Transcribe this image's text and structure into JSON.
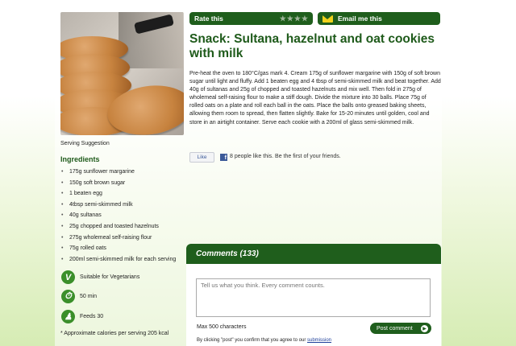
{
  "photo": {
    "caption": "Serving Suggestion"
  },
  "rate_bar": {
    "label": "Rate this",
    "stars": "★★★★"
  },
  "email_bar": {
    "label": "Email me this"
  },
  "recipe": {
    "title": "Snack: Sultana, hazelnut and oat cookies with milk",
    "method": "Pre-heat the oven to 180°C/gas mark 4. Cream 175g of sunflower margarine with 150g of soft brown sugar until light and fluffy. Add 1 beaten egg and 4 tbsp of semi-skimmed milk and beat together. Add 40g of sultanas and 25g of chopped and toasted hazelnuts and mix well. Then fold in 275g of wholemeal self-raising flour to make a stiff dough. Divide the mixture into 30 balls. Place 75g of rolled oats on a plate and roll each ball in the oats. Place the balls onto greased baking sheets, allowing them room to spread, then flatten slightly. Bake for 15-20 minutes until golden, cool and store in an airtight container. Serve each cookie with a 200ml of glass semi-skimmed milk."
  },
  "ingredients": {
    "title": "Ingredients",
    "items": [
      "175g sunflower margarine",
      "150g soft brown sugar",
      "1 beaten egg",
      "4tbsp semi-skimmed milk",
      "40g sultanas",
      "25g chopped and toasted hazelnuts",
      "275g wholemeal self-raising flour",
      "75g rolled oats",
      "200ml semi-skimmed milk for each serving"
    ]
  },
  "badges": {
    "vegetarian": {
      "icon": "V",
      "label": "Suitable for Vegetarians"
    },
    "time": {
      "icon": "⏱",
      "label": "50 min"
    },
    "feeds": {
      "icon": "♟",
      "label": "Feeds 30"
    }
  },
  "approx_calories": "* Approximate calories per serving 205 kcal",
  "facebook": {
    "like_label": "Like",
    "like_text": "8 people like this. Be the first of your friends."
  },
  "comments": {
    "header": "Comments (133)",
    "placeholder": "Tell us what you think. Every comment counts.",
    "max_chars": "Max 500 characters",
    "post_label": "Post comment",
    "terms_prefix": "By clicking \"post\" you confirm that you agree to our ",
    "terms_link": "submission"
  },
  "colors": {
    "brand_green": "#1f5e1c",
    "title_green": "#1e5a1a",
    "email_yellow": "#f0d21c",
    "facebook_blue": "#3b5998"
  }
}
